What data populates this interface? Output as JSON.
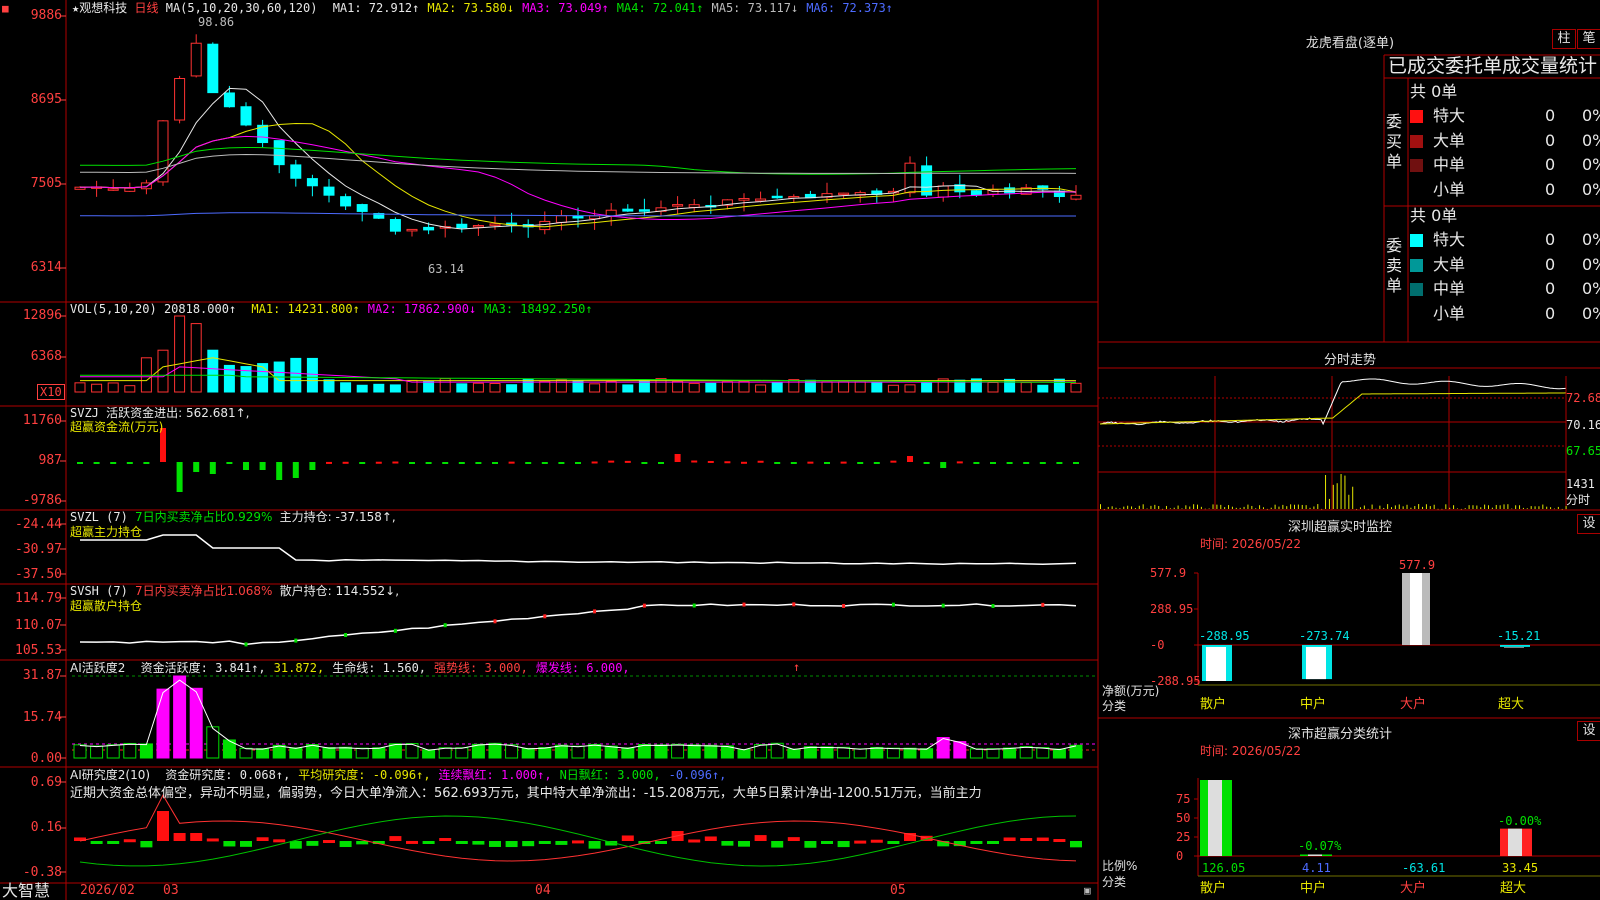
{
  "stock": {
    "star": "★",
    "name": "观想科技",
    "period": "日线"
  },
  "main": {
    "ma_header": "MA(5,10,20,30,60,120)",
    "ma": [
      {
        "label": "MA1: 72.912↑",
        "color": "#e8e8e8"
      },
      {
        "label": "MA2: 73.580↓",
        "color": "#e6e600"
      },
      {
        "label": "MA3: 73.049↑",
        "color": "#ff00ff"
      },
      {
        "label": "MA4: 72.041↑",
        "color": "#00e000"
      },
      {
        "label": "MA5: 73.117↓",
        "color": "#bbbbbb"
      },
      {
        "label": "MA6: 72.373↑",
        "color": "#4d6bff"
      }
    ],
    "y_ticks": [
      "9886",
      "8695",
      "7505",
      "6314"
    ],
    "high_label": "98.86",
    "low_label": "63.14",
    "corner_icon": "settings-icon"
  },
  "vol": {
    "label": "VOL(5,10,20)",
    "value": "20818.000↑",
    "ma": [
      {
        "label": "MA1: 14231.800↑",
        "color": "#e6e600"
      },
      {
        "label": "MA2: 17862.900↓",
        "color": "#ff00ff"
      },
      {
        "label": "MA3: 18492.250↑",
        "color": "#00e000"
      }
    ],
    "y_ticks": [
      "12896",
      "6368"
    ],
    "unit": "X10"
  },
  "svzj": {
    "label": "SVZJ",
    "value_label": "活跃资金进出: 562.681↑,",
    "subtitle": "超赢资金流(万元)",
    "y_ticks": [
      "11760",
      "987",
      "-9786"
    ]
  },
  "svzl": {
    "label": "SVZL (7)",
    "ratio": "7日内买卖净占比0.929%",
    "holding": "主力持仓: -37.158↑,",
    "subtitle": "超赢主力持仓",
    "y_ticks": [
      "-24.44",
      "-30.97",
      "-37.50"
    ]
  },
  "svsh": {
    "label": "SVSH (7)",
    "ratio": "7日内买卖净占比1.068%",
    "holding": "散户持仓: 114.552↓,",
    "subtitle": "超赢散户持仓",
    "y_ticks": [
      "114.79",
      "110.07",
      "105.53"
    ]
  },
  "ai_active": {
    "label": "AI活跃度2",
    "parts": [
      {
        "text": "资金活跃度: 3.841↑,",
        "color": "#e8e8e8"
      },
      {
        "text": "31.872,",
        "color": "#e6e600"
      },
      {
        "text": "生命线: 1.560,",
        "color": "#e8e8e8"
      },
      {
        "text": "强势线: 3.000,",
        "color": "#ff4040"
      },
      {
        "text": "爆发线: 6.000,",
        "color": "#ff00ff"
      }
    ],
    "arrow": "↑",
    "y_ticks": [
      "31.87",
      "15.74",
      "0.00"
    ]
  },
  "ai_research": {
    "label": "AI研究度2(10)",
    "parts": [
      {
        "text": "资金研究度: 0.068↑,",
        "color": "#e8e8e8"
      },
      {
        "text": "平均研究度: -0.096↑,",
        "color": "#e6e600"
      },
      {
        "text": "连续飘红: 1.000↑,",
        "color": "#ff00ff"
      },
      {
        "text": "N日飘红: 3.000,",
        "color": "#00e000"
      },
      {
        "text": "-0.096↑,",
        "color": "#4d6bff"
      }
    ],
    "commentary": "近期大资金总体偏空，异动不明显，偏弱势，今日大单净流入：562.693万元，其中特大单净流出：-15.208万元，大单5日累计净出-1200.51万元，当前主力",
    "y_ticks": [
      "0.69",
      "0.16",
      "-0.38"
    ]
  },
  "date_axis": {
    "brand": "大智慧",
    "labels": [
      "2026/02",
      "03",
      "04",
      "05"
    ]
  },
  "dragon": {
    "title": "龙虎看盘(逐单)",
    "btn_bar": "柱",
    "btn_pen": "笔",
    "heading": "已成交委托单成交量统计",
    "buy": {
      "side_label": "委买单",
      "total": "共 0单",
      "rows": [
        {
          "name": "特大",
          "count": "0",
          "pct": "0%",
          "color": "#ff1010"
        },
        {
          "name": "大单",
          "count": "0",
          "pct": "0%",
          "color": "#a01010"
        },
        {
          "name": "中单",
          "count": "0",
          "pct": "0%",
          "color": "#701010"
        },
        {
          "name": "小单",
          "count": "0",
          "pct": "0%",
          "color": "#000000"
        }
      ]
    },
    "sell": {
      "side_label": "委卖单",
      "total": "共 0单",
      "rows": [
        {
          "name": "特大",
          "count": "0",
          "pct": "0%",
          "color": "#00ffff"
        },
        {
          "name": "大单",
          "count": "0",
          "pct": "0%",
          "color": "#009898"
        },
        {
          "name": "中单",
          "count": "0",
          "pct": "0%",
          "color": "#006e6e"
        },
        {
          "name": "小单",
          "count": "0",
          "pct": "0%",
          "color": "#000000"
        }
      ]
    }
  },
  "intraday": {
    "title": "分时走势",
    "y_ticks": [
      "72.68",
      "70.16",
      "67.65"
    ],
    "vol_tick": "1431",
    "vol_unit": "分时"
  },
  "sz_monitor": {
    "title": "深圳超赢实时监控",
    "btn": "设",
    "time": "时间: 2026/05/22",
    "y_ticks": [
      "577.9",
      "288.95",
      "-0",
      "-288.95"
    ],
    "ylabel": "净额(万元)",
    "xlabel": "分类",
    "categories": [
      "散户",
      "中户",
      "大户",
      "超大"
    ],
    "values": [
      -288.95,
      -273.74,
      577.9,
      -15.21
    ],
    "value_labels": [
      "-288.95",
      "-273.74",
      "577.9",
      "-15.21"
    ]
  },
  "sz_classify": {
    "title": "深市超赢分类统计",
    "btn": "设",
    "time": "时间: 2026/05/22",
    "y_ticks": [
      "75",
      "50",
      "25",
      "0"
    ],
    "ylabel": "比例%",
    "xlabel": "分类",
    "categories": [
      "散户",
      "中户",
      "大户",
      "超大"
    ],
    "pct_labels": [
      "",
      "-0.07%",
      "",
      "-0.00%"
    ],
    "values": [
      126.05,
      4.11,
      -63.61,
      33.45
    ],
    "value_labels": [
      "126.05",
      "4.11",
      "-63.61",
      "33.45"
    ]
  },
  "chart_data": [
    {
      "type": "bar",
      "title": "深圳超赢实时监控",
      "ylabel": "净额(万元)",
      "categories": [
        "散户",
        "中户",
        "大户",
        "超大"
      ],
      "values": [
        -288.95,
        -273.74,
        577.9,
        -15.21
      ],
      "ylim": [
        -288.95,
        577.9
      ]
    },
    {
      "type": "bar",
      "title": "深市超赢分类统计",
      "ylabel": "比例%",
      "categories": [
        "散户",
        "中户",
        "大户",
        "超大"
      ],
      "values": [
        126.05,
        4.11,
        -63.61,
        33.45
      ],
      "ylim": [
        0,
        75
      ]
    }
  ]
}
